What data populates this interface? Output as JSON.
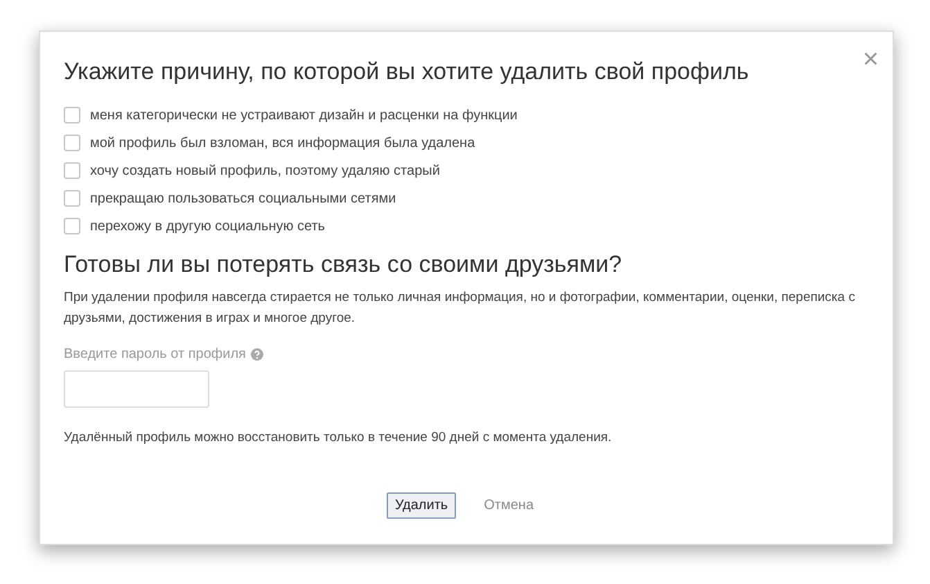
{
  "dialog": {
    "title": "Укажите причину, по которой вы хотите удалить свой профиль",
    "close": "×",
    "reasons": [
      {
        "label": "меня категорически не устраивают дизайн и расценки на функции",
        "checked": false
      },
      {
        "label": "мой профиль был взломан, вся информация была удалена",
        "checked": false
      },
      {
        "label": "хочу создать новый профиль, поэтому удаляю старый",
        "checked": false
      },
      {
        "label": "прекращаю пользоваться социальными сетями",
        "checked": false
      },
      {
        "label": "перехожу в другую социальную сеть",
        "checked": false
      }
    ],
    "question": "Готовы ли вы потерять связь со своими друзьями?",
    "warning": "При удалении профиля навсегда стирается не только личная информация, но и фотографии, комментарии, оценки, переписка с друзьями, достижения в играх и многое другое.",
    "password_label": "Введите пароль от профиля",
    "note": "Удалённый профиль можно восстановить только в течение 90 дней с момента удаления.",
    "buttons": [
      {
        "label": "Удалить",
        "kind": "primary"
      },
      {
        "label": "Отмена",
        "kind": "link"
      }
    ]
  }
}
